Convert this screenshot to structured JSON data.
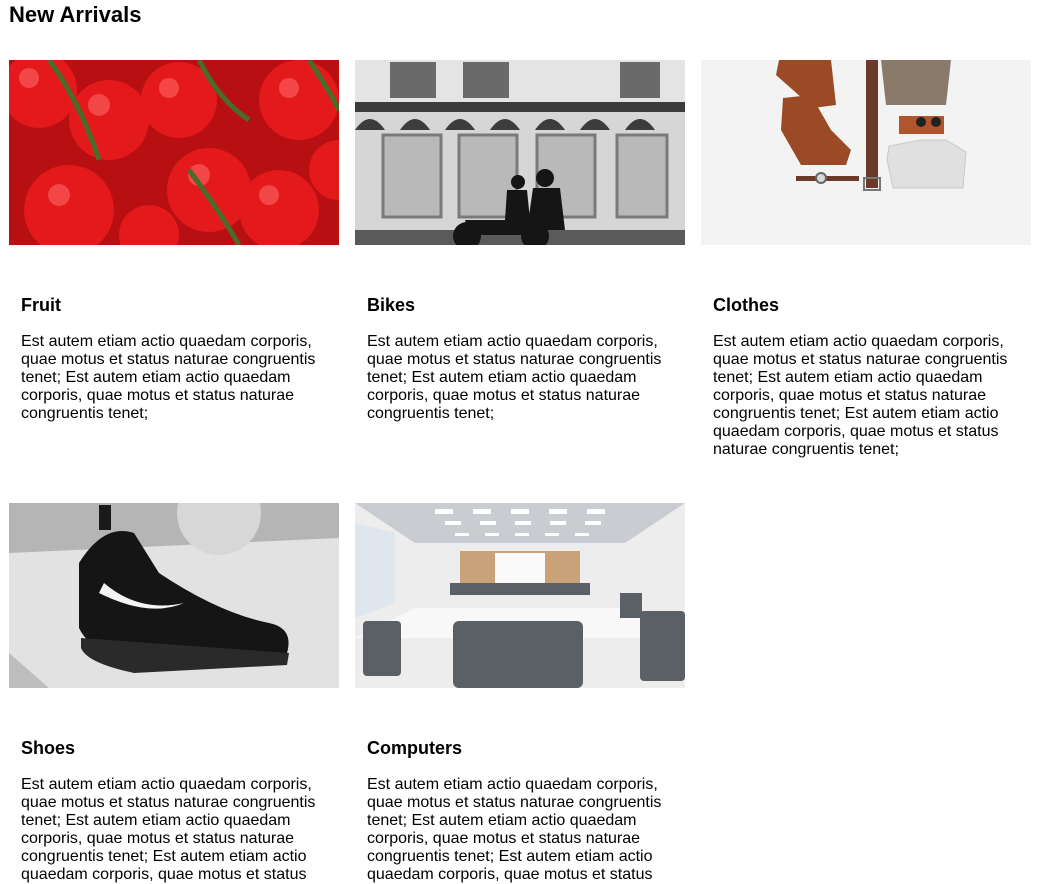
{
  "page": {
    "title": "New Arrivals"
  },
  "products": [
    {
      "title": "Fruit",
      "image_icon": "tomatoes-photo",
      "description": "Est autem etiam actio quaedam corporis, quae motus et status naturae congruentis tenet; Est autem etiam actio quaedam corporis, quae motus et status naturae congruentis tenet;"
    },
    {
      "title": "Bikes",
      "image_icon": "motorbike-street-photo",
      "description": "Est autem etiam actio quaedam corporis, quae motus et status naturae congruentis tenet; Est autem etiam actio quaedam corporis, quae motus et status naturae congruentis tenet;"
    },
    {
      "title": "Clothes",
      "image_icon": "clothing-flatlay-photo",
      "description": "Est autem etiam actio quaedam corporis, quae motus et status naturae congruentis tenet; Est autem etiam actio quaedam corporis, quae motus et status naturae congruentis tenet; Est autem etiam actio quaedam corporis, quae motus et status naturae congruentis tenet;"
    },
    {
      "title": "Shoes",
      "image_icon": "sneaker-photo",
      "description": "Est autem etiam actio quaedam corporis, quae motus et status naturae congruentis tenet; Est autem etiam actio quaedam corporis, quae motus et status naturae congruentis tenet; Est autem etiam actio quaedam corporis, quae motus et status"
    },
    {
      "title": "Computers",
      "image_icon": "conference-room-photo",
      "description": "Est autem etiam actio quaedam corporis, quae motus et status naturae congruentis tenet; Est autem etiam actio quaedam corporis, quae motus et status naturae congruentis tenet; Est autem etiam actio quaedam corporis, quae motus et status"
    }
  ]
}
